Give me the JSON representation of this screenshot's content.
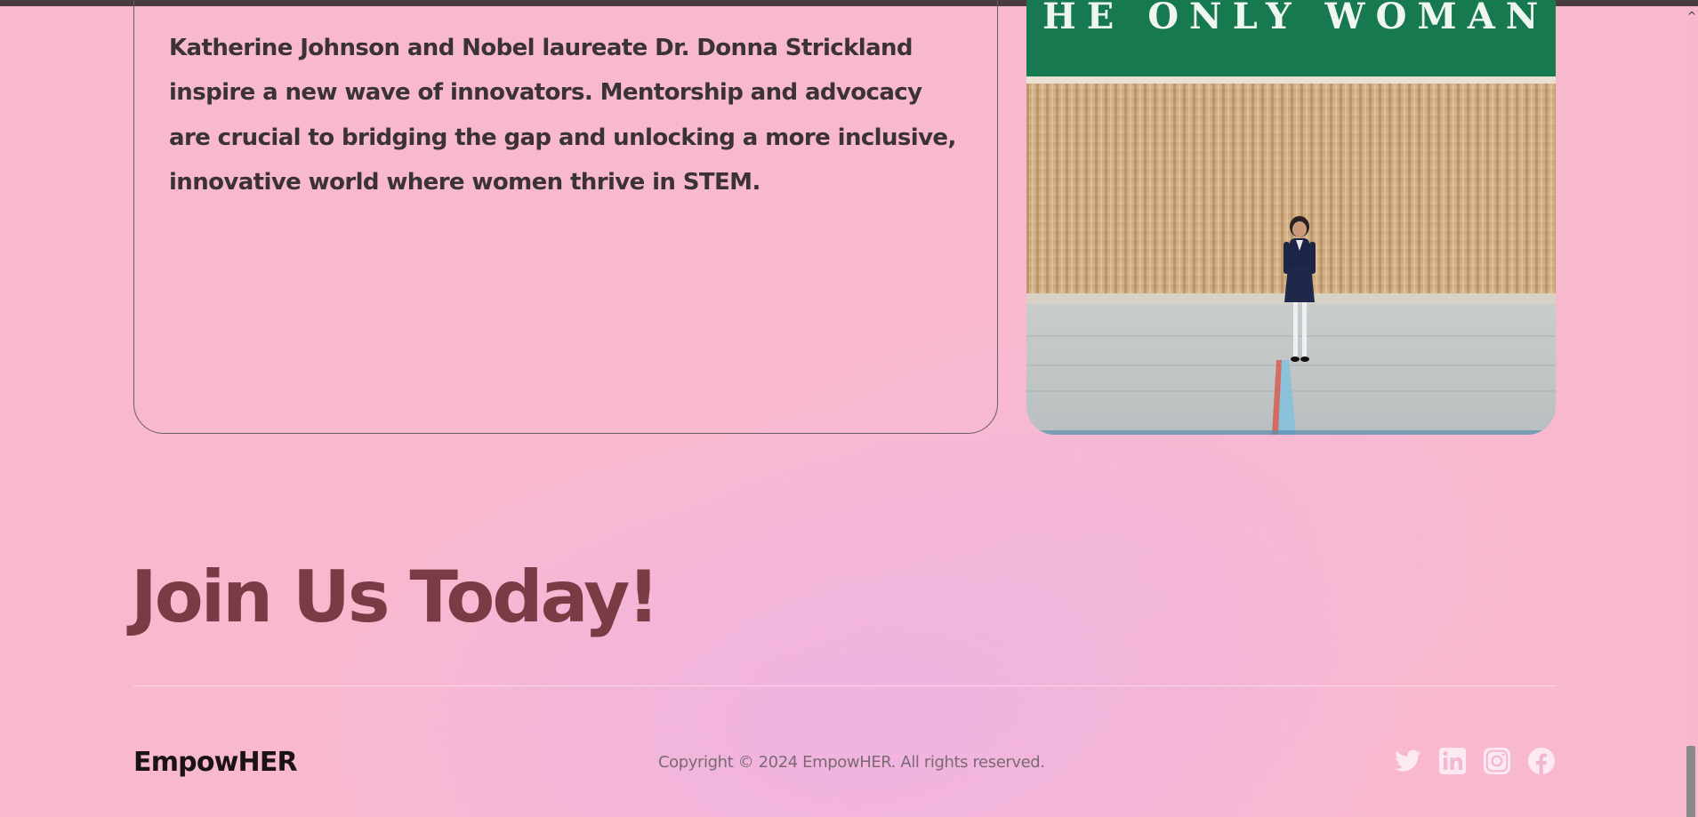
{
  "article": {
    "paragraph": "Katherine Johnson and Nobel laureate Dr. Donna Strickland inspire a new wave of innovators. Mentorship and advocacy are crucial to bridging the gap and unlocking a more inclusive, innovative world where women thrive in STEM."
  },
  "photo": {
    "banner_text": "HE ONLY WOMAN"
  },
  "cta": {
    "heading": "Join Us Today!"
  },
  "footer": {
    "brand": "EmpowHER",
    "copyright": "Copyright © 2024 EmpowHER. All rights reserved.",
    "social_icons": [
      "twitter-icon",
      "linkedin-icon",
      "instagram-icon",
      "facebook-icon"
    ]
  },
  "colors": {
    "background": "#f8b9cf",
    "heading": "#7a3b44",
    "body_text": "#3b3238",
    "icon": "#fbeaf2"
  }
}
